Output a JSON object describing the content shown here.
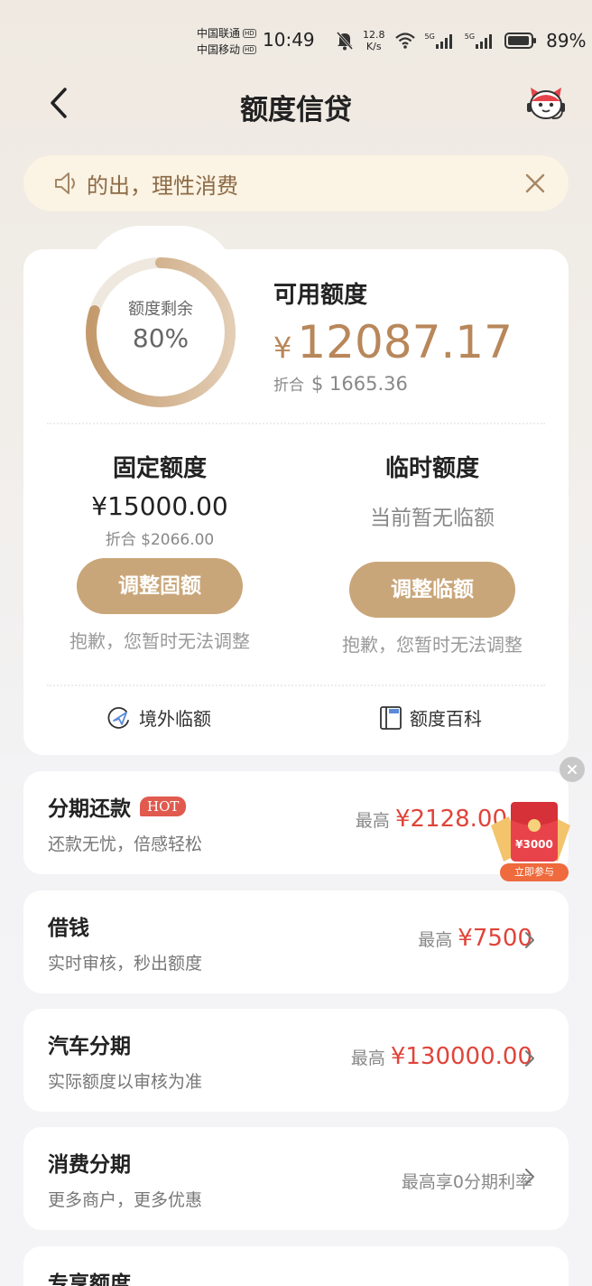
{
  "status_bar": {
    "carrier1": "中国联通",
    "carrier2": "中国移动",
    "hd": "HD",
    "time": "10:49",
    "net_speed_value": "12.8",
    "net_speed_unit": "K/s",
    "signal1": "5G",
    "signal2": "5G",
    "battery": "89%"
  },
  "header": {
    "title": "额度信贷"
  },
  "notice": {
    "text": "的出，理性消费"
  },
  "credit": {
    "ring_label": "额度剩余",
    "ring_percent": "80%",
    "ring_fraction": 0.8,
    "available_label": "可用额度",
    "available_currency": "¥",
    "available_amount": "12087.17",
    "available_usd_prefix": "折合",
    "available_usd": "$ 1665.36",
    "fixed": {
      "title": "固定额度",
      "amount": "¥15000.00",
      "usd": "折合 $2066.00",
      "button": "调整固额",
      "note": "抱歉，您暂时无法调整"
    },
    "temp": {
      "title": "临时额度",
      "status": "当前暂无临额",
      "button": "调整临额",
      "note": "抱歉，您暂时无法调整"
    },
    "links": {
      "overseas": "境外临额",
      "wiki": "额度百科"
    }
  },
  "products": [
    {
      "title": "分期还款",
      "badge": "HOT",
      "subtitle": "还款无忧，倍感轻松",
      "prefix": "最高",
      "amount": "¥2128.00"
    },
    {
      "title": "借钱",
      "subtitle": "实时审核，秒出额度",
      "prefix": "最高",
      "amount": "¥7500"
    },
    {
      "title": "汽车分期",
      "subtitle": "实际额度以审核为准",
      "prefix": "最高",
      "amount": "¥130000.00"
    },
    {
      "title": "消费分期",
      "subtitle": "更多商户，更多优惠",
      "promo": "最高享0分期利率"
    },
    {
      "title": "专享额度"
    }
  ],
  "floating_promo": {
    "amount": "¥3000",
    "button": "立即参与"
  },
  "colors": {
    "accent": "#c9a679",
    "amount_gold": "#b8875a",
    "price_red": "#e0443a"
  }
}
